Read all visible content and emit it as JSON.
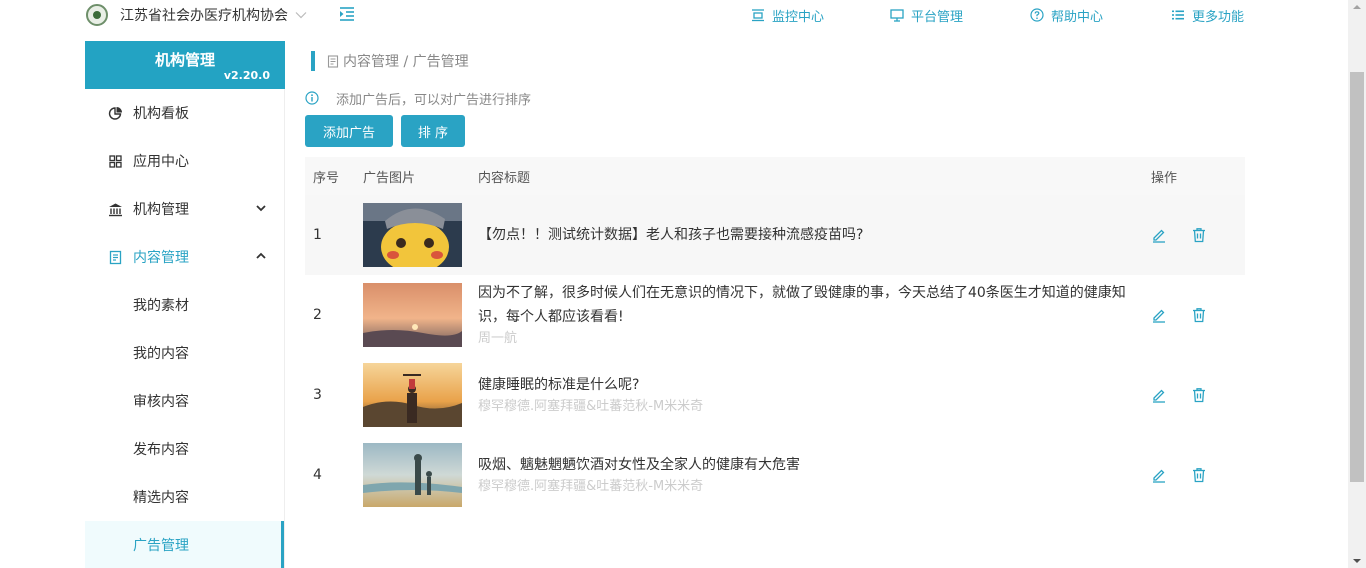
{
  "header": {
    "org_name": "江苏省社会办医疗机构协会",
    "nav": [
      {
        "label": "监控中心",
        "icon": "monitor-center-icon"
      },
      {
        "label": "平台管理",
        "icon": "desktop-icon"
      },
      {
        "label": "帮助中心",
        "icon": "help-circle-icon"
      },
      {
        "label": "更多功能",
        "icon": "list-icon"
      }
    ]
  },
  "sidebar": {
    "brand_title": "机构管理",
    "version": "v2.20.0",
    "items": [
      {
        "label": "机构看板",
        "icon": "pie-chart-icon"
      },
      {
        "label": "应用中心",
        "icon": "grid-icon"
      },
      {
        "label": "机构管理",
        "icon": "institution-icon"
      },
      {
        "label": "内容管理",
        "icon": "document-icon"
      }
    ],
    "sub_items": [
      {
        "label": "我的素材"
      },
      {
        "label": "我的内容"
      },
      {
        "label": "审核内容"
      },
      {
        "label": "发布内容"
      },
      {
        "label": "精选内容"
      },
      {
        "label": "广告管理"
      }
    ]
  },
  "breadcrumb": {
    "text": "内容管理 / 广告管理"
  },
  "tip": {
    "text": "添加广告后，可以对广告进行排序"
  },
  "actions": {
    "add_label": "添加广告",
    "sort_label": "排 序"
  },
  "table": {
    "headers": {
      "index": "序号",
      "image": "广告图片",
      "title": "内容标题",
      "ops": "操作"
    },
    "rows": [
      {
        "index": "1",
        "title": "【勿点！！测试统计数据】老人和孩子也需要接种流感疫苗吗?",
        "author": ""
      },
      {
        "index": "2",
        "title": "因为不了解，很多时候人们在无意识的情况下，就做了毁健康的事，今天总结了40条医生才知道的健康知识，每个人都应该看看!",
        "author": "周一航"
      },
      {
        "index": "3",
        "title": "健康睡眠的标准是什么呢?",
        "author": "穆罕穆德.阿塞拜疆&吐蕃范秋-M米米奇"
      },
      {
        "index": "4",
        "title": "吸烟、魑魅魍魉饮酒对女性及全家人的健康有大危害",
        "author": "穆罕穆德.阿塞拜疆&吐蕃范秋-M米米奇"
      }
    ]
  },
  "colors": {
    "accent": "#2aa3c4",
    "brand": "#23a3c3",
    "active_bg": "#f0fbfd"
  }
}
